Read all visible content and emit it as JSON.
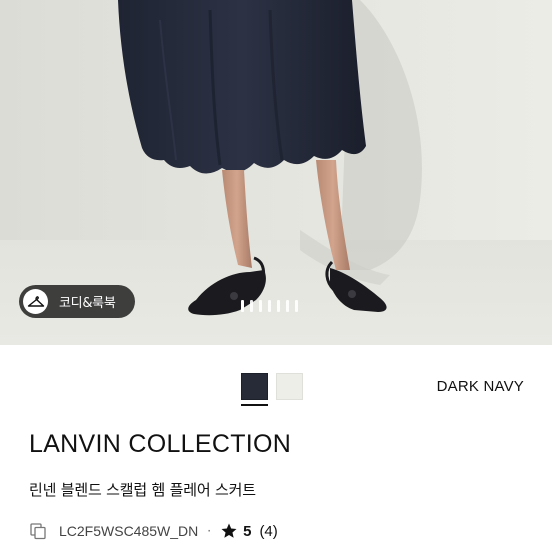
{
  "product_image": {
    "coordi_button_label": "코디&룩북",
    "pager_count": 7,
    "pager_active_index": 0
  },
  "color_selector": {
    "options": [
      {
        "name": "DARK NAVY",
        "hex": "#262b37",
        "selected": true
      },
      {
        "name": "IVORY",
        "hex": "#eeeee9",
        "selected": false
      }
    ],
    "selected_label": "DARK NAVY"
  },
  "product": {
    "brand": "LANVIN COLLECTION",
    "name": "린넨 블렌드 스캘럽 헴 플레어 스커트",
    "sku": "LC2F5WSC485W_DN",
    "separator": "·",
    "rating": "5",
    "review_count": "(4)"
  }
}
